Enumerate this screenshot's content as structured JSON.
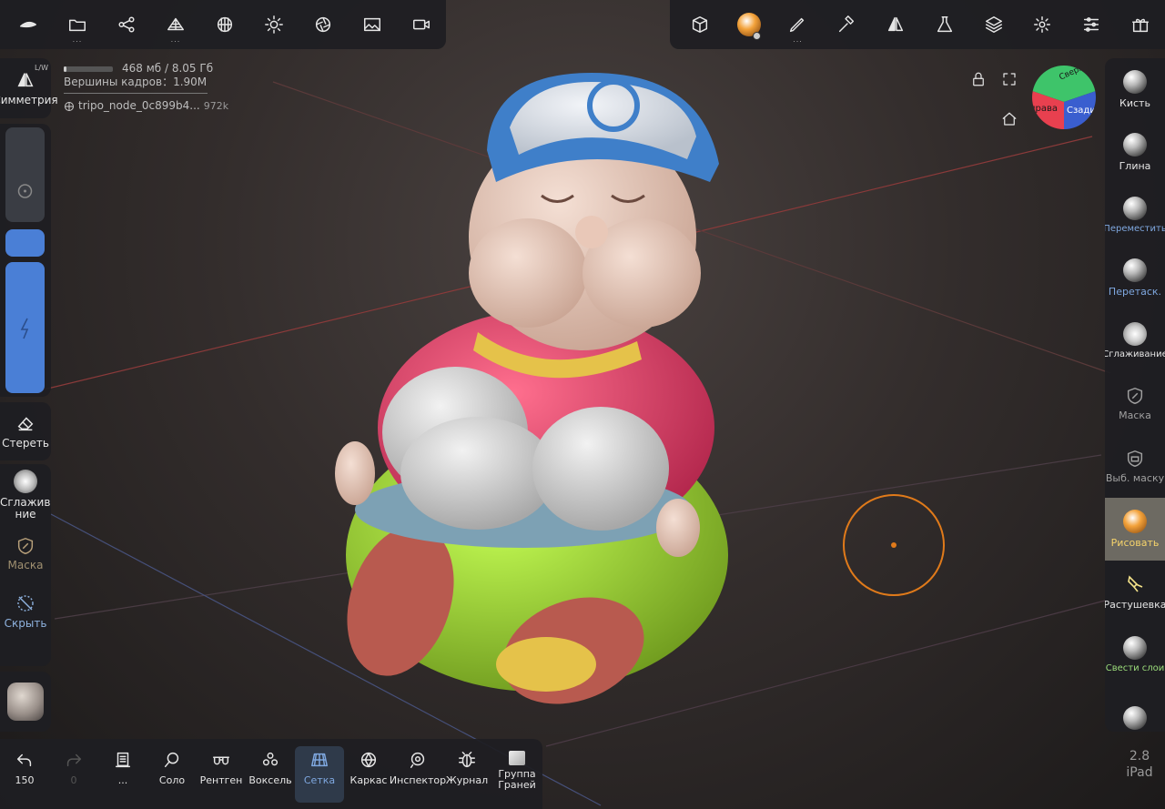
{
  "top_left_tools": [
    {
      "icon": "nomad-logo-icon"
    },
    {
      "icon": "folder-icon",
      "more": "..."
    },
    {
      "icon": "scene-graph-icon"
    },
    {
      "icon": "mesh-icon",
      "more": "..."
    },
    {
      "icon": "topology-icon"
    },
    {
      "icon": "light-icon"
    },
    {
      "icon": "camera-aperture-icon"
    },
    {
      "icon": "image-icon"
    },
    {
      "icon": "video-camera-icon"
    }
  ],
  "top_right_tools": [
    {
      "icon": "cube-icon"
    },
    {
      "icon": "material-sphere-icon"
    },
    {
      "icon": "brush-stroke-icon",
      "more": "..."
    },
    {
      "icon": "hammer-icon"
    },
    {
      "icon": "symmetry-icon"
    },
    {
      "icon": "flask-icon"
    },
    {
      "icon": "layers-icon"
    },
    {
      "icon": "settings-icon"
    },
    {
      "icon": "sliders-icon"
    },
    {
      "icon": "gift-icon"
    }
  ],
  "info": {
    "memory": "468 мб / 8.05 Гб",
    "memory_fraction": 0.06,
    "vertices": "Вершины кадров：1.90M",
    "node_name": "tripo_node_0c899b4...",
    "node_count": "972k"
  },
  "left": {
    "symmetry_label": "Симметрия",
    "symmetry_badge": "L/W",
    "erase_label": "Стереть",
    "smooth_label": "Сглажива ние",
    "mask_label": "Маска",
    "hide_label": "Скрыть"
  },
  "right_tools": [
    {
      "label": "Кисть",
      "color": "#e6e6e6"
    },
    {
      "label": "Глина",
      "color": "#e6e6e6"
    },
    {
      "label": "Переместить",
      "color": "#7fa8e0"
    },
    {
      "label": "Перетаск.",
      "color": "#7fa8e0"
    },
    {
      "label": "Сглаживание",
      "color": "#e6e6e6"
    },
    {
      "label": "Маска",
      "color": "#a0a0a0"
    },
    {
      "label": "Выб. маску",
      "color": "#a0a0a0"
    },
    {
      "label": "Рисовать",
      "color": "#f5d36b"
    },
    {
      "label": "Растушевка",
      "color": "#e6e6e6"
    },
    {
      "label": "Свести слои",
      "color": "#9bdc7a"
    },
    {
      "label": "",
      "color": "#e6e6e6"
    }
  ],
  "bottom_tools": [
    {
      "icon": "undo-icon",
      "label": "150"
    },
    {
      "icon": "redo-icon",
      "label": "0"
    },
    {
      "icon": "history-icon",
      "label": "..."
    },
    {
      "icon": "search-icon",
      "label": "Соло"
    },
    {
      "icon": "xray-glasses-icon",
      "label": "Рентген"
    },
    {
      "icon": "voxel-icon",
      "label": "Воксель"
    },
    {
      "icon": "grid-icon",
      "label": "Сетка"
    },
    {
      "icon": "wireframe-icon",
      "label": "Каркас"
    },
    {
      "icon": "eye-inspect-icon",
      "label": "Инспектор"
    },
    {
      "icon": "bug-icon",
      "label": "Журнал"
    },
    {
      "icon": "face-group-icon",
      "label": "Группа Граней"
    }
  ],
  "gizmo": {
    "top": "Сверху",
    "right": "Справа",
    "back": "Сзади"
  },
  "version": {
    "number": "2.8",
    "device": "iPad"
  },
  "colors": {
    "accent_blue": "#4a7fd6",
    "brush_cursor": "#e07a1a"
  }
}
